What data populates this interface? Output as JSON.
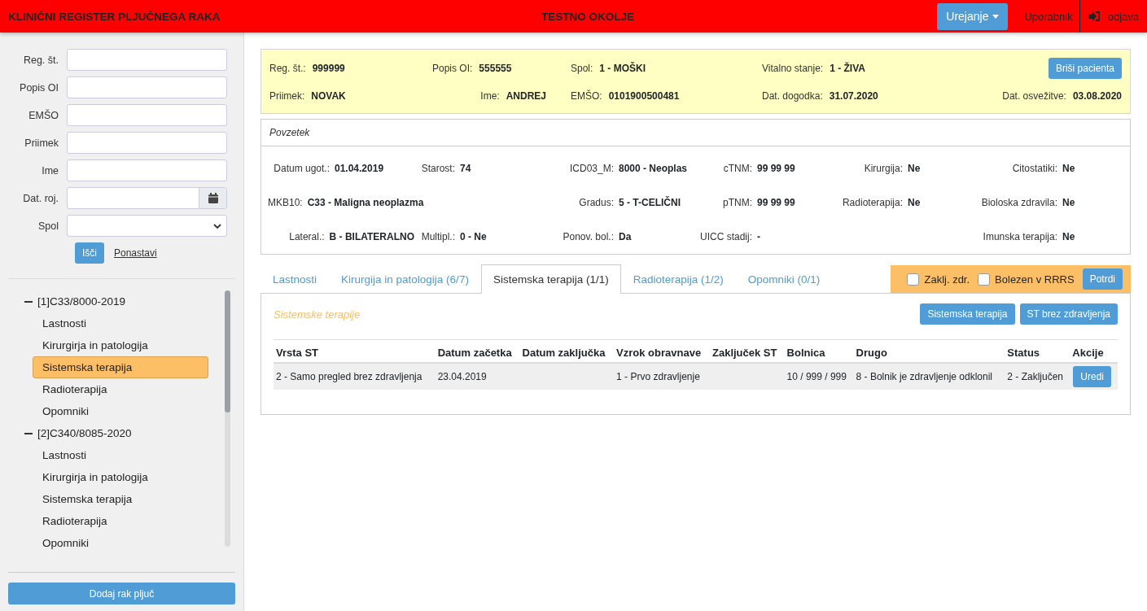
{
  "header": {
    "title": "KLINIČNI REGISTER PLJUČNEGA RAKA",
    "environment": "TESTNO OKOLJE",
    "menu_button": "Urejanje",
    "user_link": "Uporabnik",
    "logout": "odjava"
  },
  "search_form": {
    "fields": [
      {
        "label": "Reg. št.",
        "kind": "text"
      },
      {
        "label": "Popis OI",
        "kind": "text"
      },
      {
        "label": "EMŠO",
        "kind": "text"
      },
      {
        "label": "Priimek",
        "kind": "text"
      },
      {
        "label": "Ime",
        "kind": "text"
      },
      {
        "label": "Dat. roj.",
        "kind": "date"
      },
      {
        "label": "Spol",
        "kind": "select"
      }
    ],
    "search_button": "Išči",
    "reset_link": "Ponastavi"
  },
  "tree": [
    {
      "label": "[1]C33/8000-2019",
      "expanded": true,
      "children": [
        {
          "label": "Lastnosti",
          "selected": false
        },
        {
          "label": "Kirurgirja in patologija",
          "selected": false
        },
        {
          "label": "Sistemska terapija",
          "selected": true
        },
        {
          "label": "Radioterapija",
          "selected": false
        },
        {
          "label": "Opomniki",
          "selected": false
        }
      ]
    },
    {
      "label": "[2]C340/8085-2020",
      "expanded": true,
      "children": [
        {
          "label": "Lastnosti",
          "selected": false
        },
        {
          "label": "Kirurgirja in patologija",
          "selected": false
        },
        {
          "label": "Sistemska terapija",
          "selected": false
        },
        {
          "label": "Radioterapija",
          "selected": false
        },
        {
          "label": "Opomniki",
          "selected": false
        }
      ]
    }
  ],
  "add_button": "Dodaj rak pljuč",
  "patient": {
    "rows": [
      [
        {
          "label": "Reg. št.:",
          "value": "999999"
        },
        {
          "label": "Popis OI:",
          "value": "555555"
        },
        {
          "label": "Spol:",
          "value": "1 - MOŠKI"
        },
        {
          "label": "Vitalno stanje:",
          "value": "1 - ŽIVA"
        }
      ],
      [
        {
          "label": "Priimek:",
          "value": "NOVAK"
        },
        {
          "label": "Ime:",
          "value": "ANDREJ"
        },
        {
          "label": "EMŠO:",
          "value": "0101900500481"
        },
        {
          "label": "Dat. dogodka:",
          "value": "31.07.2020"
        },
        {
          "label": "Dat. osvežitve:",
          "value": "03.08.2020"
        }
      ]
    ],
    "delete_button": "Briši pacienta"
  },
  "summary": {
    "title": "Povzetek",
    "rows": [
      [
        {
          "label": "Datum ugot.:",
          "value": "01.04.2019"
        },
        {
          "label": "Starost:",
          "value": "74"
        },
        {
          "label": "ICD03_M:",
          "value": "8000 - Neoplas"
        },
        {
          "label": "cTNM:",
          "value": "99 99 99"
        },
        {
          "label": "Kirurgija:",
          "value": "Ne"
        },
        {
          "label": "Citostatiki:",
          "value": "Ne"
        }
      ],
      [
        {
          "label": "MKB10:",
          "value": "C33 - Maligna neoplazma"
        },
        null,
        {
          "label": "Gradus:",
          "value": "5 - T-CELIČNI"
        },
        {
          "label": "pTNM:",
          "value": "99 99 99"
        },
        {
          "label": "Radioterapija:",
          "value": "Ne"
        },
        {
          "label": "Bioloska zdravila:",
          "value": "Ne"
        }
      ],
      [
        {
          "label": "Lateral.:",
          "value": "B - BILATERALNO"
        },
        {
          "label": "Multipl.:",
          "value": "0 - Ne"
        },
        {
          "label": "Ponov. bol.:",
          "value": "Da"
        },
        {
          "label": "UICC stadij:",
          "value": "-"
        },
        null,
        {
          "label": "Imunska terapija:",
          "value": "Ne"
        }
      ]
    ]
  },
  "tabs": [
    {
      "label": "Lastnosti",
      "selected": false
    },
    {
      "label": "Kirurgija in patologija (6/7)",
      "selected": false
    },
    {
      "label": "Sistemska terapija (1/1)",
      "selected": true
    },
    {
      "label": "Radioterapija (1/2)",
      "selected": false
    },
    {
      "label": "Opomniki (0/1)",
      "selected": false
    }
  ],
  "tab_actions": {
    "checkboxes": [
      {
        "label": "Zaklj. zdr.",
        "checked": false
      },
      {
        "label": "Bolezen v RRRS",
        "checked": false
      }
    ],
    "confirm_button": "Potrdi"
  },
  "panel": {
    "title": "Sistemske terapije",
    "buttons": [
      "Sistemska terapija",
      "ST brez zdravljenja"
    ],
    "table": {
      "columns": [
        "Vrsta ST",
        "Datum začetka",
        "Datum zaključka",
        "Vzrok obravnave",
        "Zaključek ST",
        "Bolnica",
        "Drugo",
        "Status",
        "Akcije"
      ],
      "rows": [
        {
          "cells": [
            "2 - Samo pregled brez zdravljenja",
            "23.04.2019",
            "",
            "1 - Prvo zdravljenje",
            "",
            "10 / 999 / 999",
            "8 - Bolnik je zdravljenje odklonil",
            "2 - Zaključen"
          ],
          "action": "Uredi"
        }
      ]
    }
  }
}
